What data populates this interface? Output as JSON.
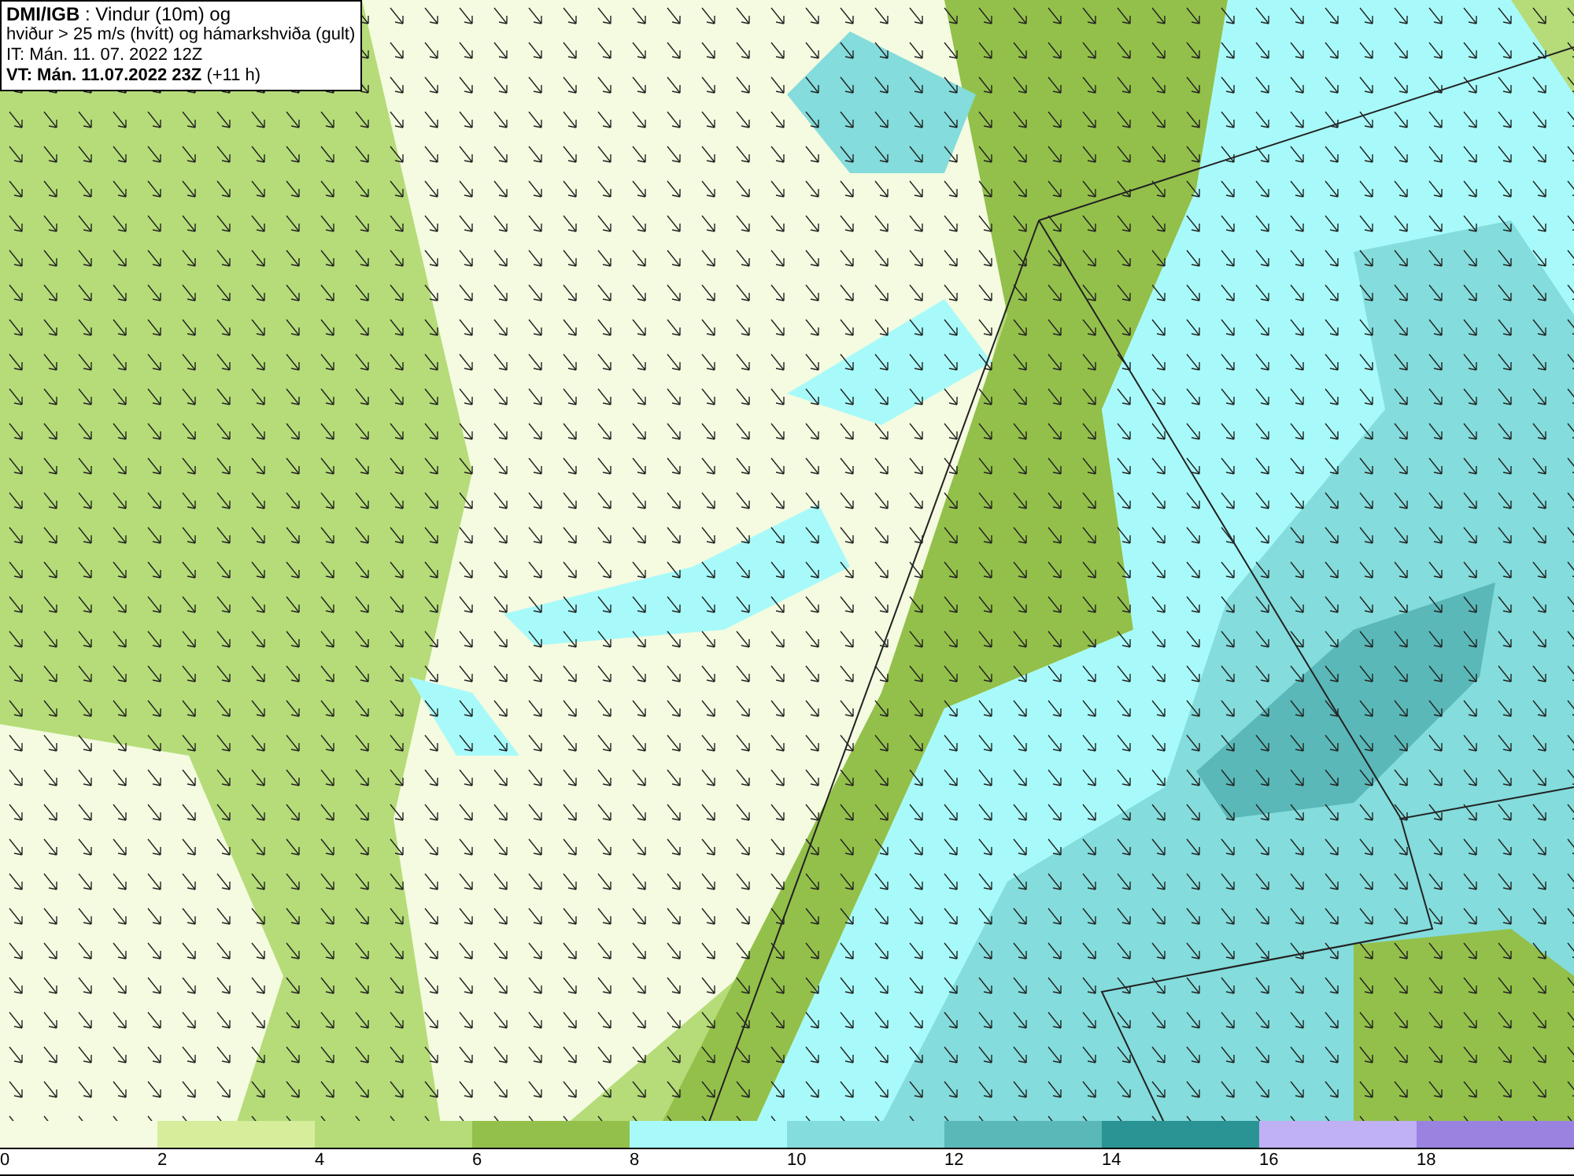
{
  "info_box": {
    "lines": [
      "**DMI/IGB** : Vindur (10m) og",
      "hviður > 25 m/s (hvítt) og hámarkshviða (gult)",
      "IT: Mán. 11. 07. 2022 12Z",
      "**VT: Mán. 11.07.2022 23Z** (+11 h)"
    ]
  },
  "legend": {
    "bins": [
      {
        "color": "#f4fbe0"
      },
      {
        "color": "#d6ee9c"
      },
      {
        "color": "#b5dc78"
      },
      {
        "color": "#93c04a"
      },
      {
        "color": "#a8fafa"
      },
      {
        "color": "#84dcdc"
      },
      {
        "color": "#5ab8b8"
      },
      {
        "color": "#2a9494"
      },
      {
        "color": "#c0b0f4"
      },
      {
        "color": "#9a82e0"
      }
    ],
    "labels": [
      "0",
      "2",
      "4",
      "6",
      "8",
      "10",
      "12",
      "14",
      "16",
      "18"
    ]
  }
}
